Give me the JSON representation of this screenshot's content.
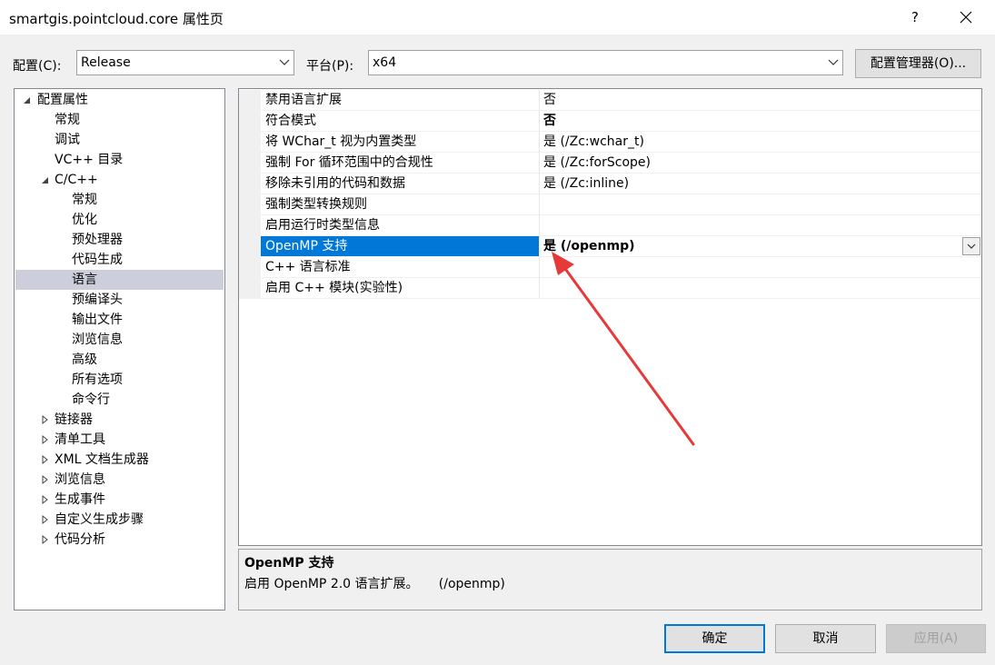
{
  "window": {
    "title": "smartgis.pointcloud.core 属性页",
    "help_label": "?"
  },
  "toolbar": {
    "config_label": "配置(C):",
    "config_value": "Release",
    "platform_label": "平台(P):",
    "platform_value": "x64",
    "config_manager_label": "配置管理器(O)..."
  },
  "tree": {
    "items": [
      {
        "label": "配置属性",
        "state": "expanded"
      },
      {
        "label": "常规"
      },
      {
        "label": "调试"
      },
      {
        "label": "VC++ 目录"
      },
      {
        "label": "C/C++",
        "state": "expanded"
      },
      {
        "label": "常规"
      },
      {
        "label": "优化"
      },
      {
        "label": "预处理器"
      },
      {
        "label": "代码生成"
      },
      {
        "label": "语言",
        "selected": true
      },
      {
        "label": "预编译头"
      },
      {
        "label": "输出文件"
      },
      {
        "label": "浏览信息"
      },
      {
        "label": "高级"
      },
      {
        "label": "所有选项"
      },
      {
        "label": "命令行"
      },
      {
        "label": "链接器",
        "state": "collapsed"
      },
      {
        "label": "清单工具",
        "state": "collapsed"
      },
      {
        "label": "XML 文档生成器",
        "state": "collapsed"
      },
      {
        "label": "浏览信息",
        "state": "collapsed"
      },
      {
        "label": "生成事件",
        "state": "collapsed"
      },
      {
        "label": "自定义生成步骤",
        "state": "collapsed"
      },
      {
        "label": "代码分析",
        "state": "collapsed"
      }
    ]
  },
  "properties": [
    {
      "name": "禁用语言扩展",
      "value": "否"
    },
    {
      "name": "符合模式",
      "value": "否",
      "bold": true
    },
    {
      "name": "将 WChar_t 视为内置类型",
      "value": "是 (/Zc:wchar_t)"
    },
    {
      "name": "强制 For 循环范围中的合规性",
      "value": "是 (/Zc:forScope)"
    },
    {
      "name": "移除未引用的代码和数据",
      "value": "是 (/Zc:inline)"
    },
    {
      "name": "强制类型转换规则",
      "value": ""
    },
    {
      "name": "启用运行时类型信息",
      "value": ""
    },
    {
      "name": "OpenMP 支持",
      "value": "是 (/openmp)",
      "bold": true,
      "selected": true
    },
    {
      "name": "C++ 语言标准",
      "value": ""
    },
    {
      "name": "启用 C++ 模块(实验性)",
      "value": ""
    }
  ],
  "description": {
    "title": "OpenMP 支持",
    "text": "启用 OpenMP 2.0 语言扩展。     (/openmp)"
  },
  "buttons": {
    "ok": "确定",
    "cancel": "取消",
    "apply": "应用(A)"
  },
  "colors": {
    "selection": "#0078d7",
    "annotation_arrow": "#e8393a"
  }
}
